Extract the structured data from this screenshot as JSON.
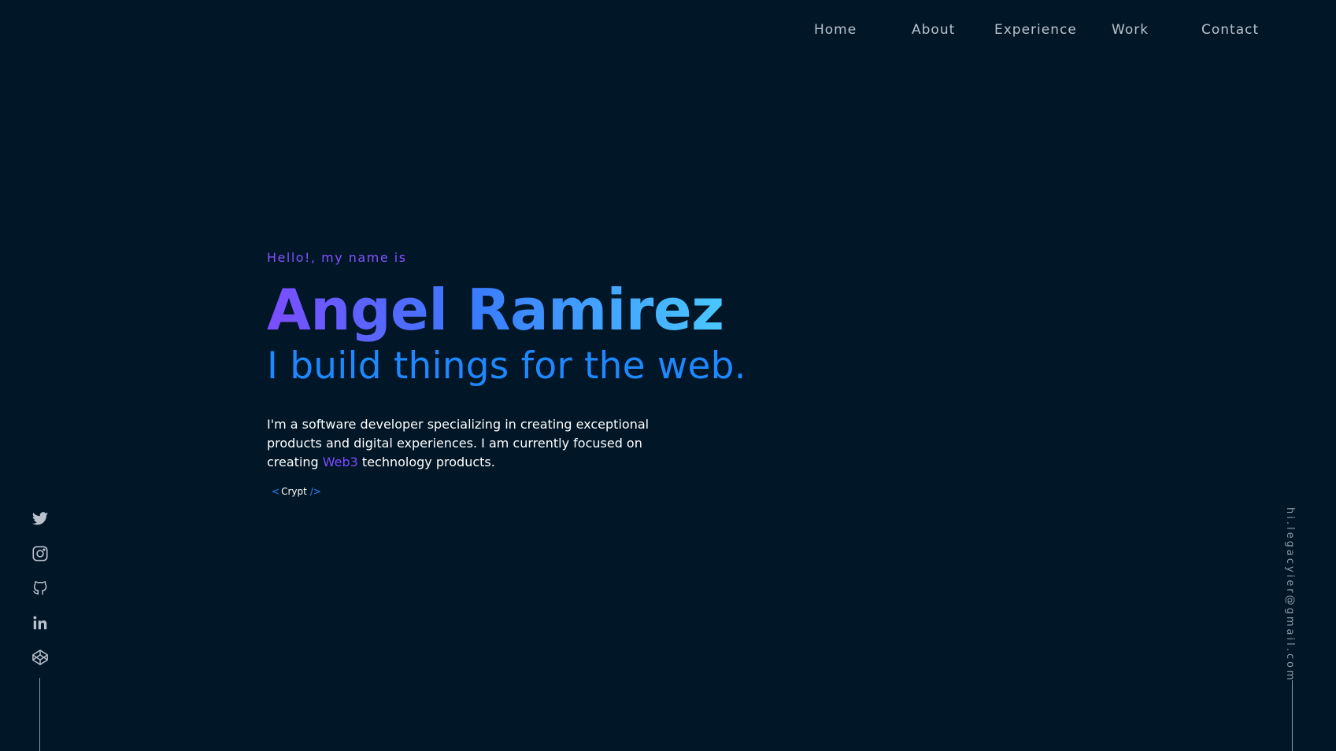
{
  "nav": {
    "items": [
      {
        "label": "Home"
      },
      {
        "label": "About"
      },
      {
        "label": "Experience"
      },
      {
        "label": "Work"
      },
      {
        "label": "Contact"
      }
    ]
  },
  "hero": {
    "greeting": "Hello!, my name is",
    "name": "Angel Ramirez",
    "tagline": "I build things for the web.",
    "bio_part1": "I'm a software developer specializing in creating exceptional products and digital experiences. I am currently focused on creating ",
    "bio_accent": "Web3",
    "bio_part2": " technology products.",
    "crypt_open": "<",
    "crypt_label": "Crypt",
    "crypt_close": "/>"
  },
  "social": {
    "icons": [
      "twitter-icon",
      "instagram-icon",
      "github-icon",
      "linkedin-icon",
      "codepen-icon"
    ]
  },
  "email": {
    "address": "hi.legacyier@gmail.com"
  },
  "colors": {
    "background": "#011627",
    "accent_purple": "#7b4dff",
    "accent_blue": "#1e88ff",
    "text_muted": "#8a99a8"
  }
}
